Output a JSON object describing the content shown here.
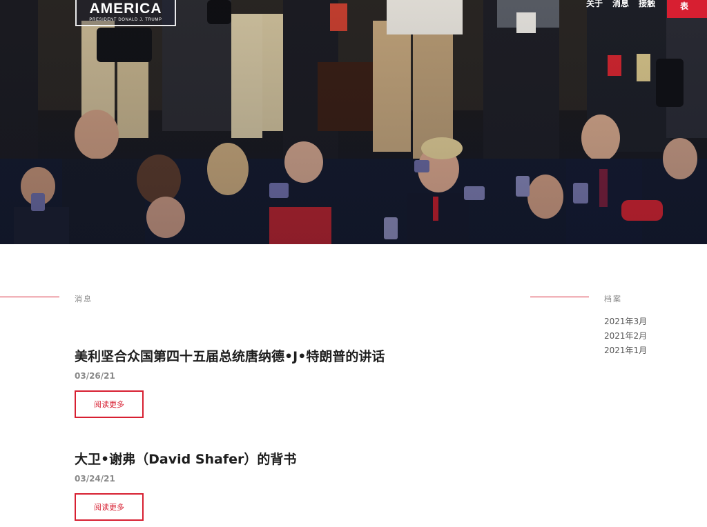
{
  "brand": {
    "logo_text": "AMERICA",
    "logo_subtext": "PRESIDENT DONALD J. TRUMP",
    "accent_color": "#d71f31"
  },
  "nav": {
    "items": [
      {
        "label": "关于"
      },
      {
        "label": "消息"
      },
      {
        "label": "接触"
      }
    ],
    "cta_label": "表"
  },
  "hero": {
    "image_description": "crowd photo"
  },
  "news": {
    "section_label": "消息",
    "posts": [
      {
        "title": "美利坚合众国第四十五届总统唐纳德•J•特朗普的讲话",
        "date": "03/26/21",
        "read_more": "阅读更多"
      },
      {
        "title": "大卫•谢弗（David Shafer）的背书",
        "date": "03/24/21",
        "read_more": "阅读更多"
      }
    ]
  },
  "archive": {
    "section_label": "档案",
    "items": [
      "2021年3月",
      "2021年2月",
      "2021年1月"
    ]
  }
}
